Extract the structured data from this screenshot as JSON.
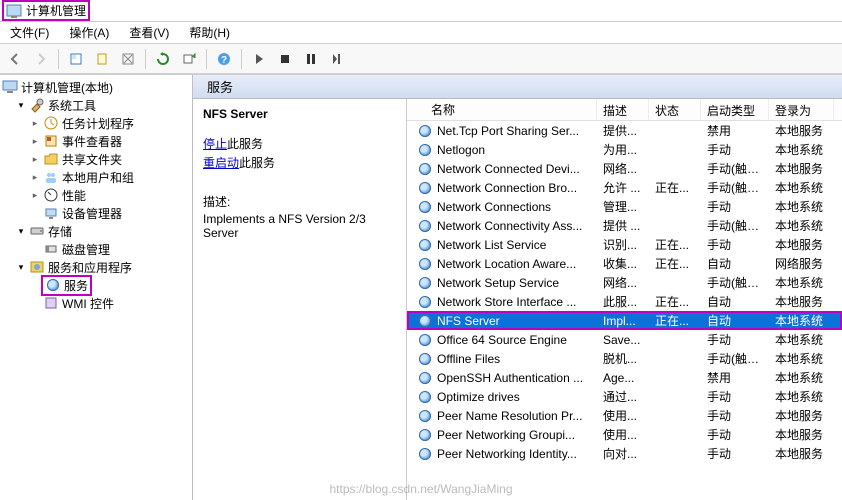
{
  "window": {
    "title": "计算机管理"
  },
  "menus": [
    "文件(F)",
    "操作(A)",
    "查看(V)",
    "帮助(H)"
  ],
  "tree": {
    "root": "计算机管理(本地)",
    "sections": [
      {
        "label": "系统工具",
        "expanded": true,
        "children": [
          {
            "label": "任务计划程序",
            "icon": "clock-icon"
          },
          {
            "label": "事件查看器",
            "icon": "event-icon"
          },
          {
            "label": "共享文件夹",
            "icon": "folder-icon"
          },
          {
            "label": "本地用户和组",
            "icon": "users-icon"
          },
          {
            "label": "性能",
            "icon": "perf-icon"
          },
          {
            "label": "设备管理器",
            "icon": "device-icon"
          }
        ]
      },
      {
        "label": "存储",
        "expanded": true,
        "children": [
          {
            "label": "磁盘管理",
            "icon": "disk-icon"
          }
        ]
      },
      {
        "label": "服务和应用程序",
        "expanded": true,
        "children": [
          {
            "label": "服务",
            "icon": "gear-icon",
            "highlighted": true
          },
          {
            "label": "WMI 控件",
            "icon": "wmi-icon"
          }
        ]
      }
    ]
  },
  "right": {
    "header": "服务",
    "detail": {
      "selected": "NFS Server",
      "stop_link": "停止",
      "stop_suffix": "此服务",
      "restart_link": "重启动",
      "restart_suffix": "此服务",
      "desc_label": "描述:",
      "desc_text": "Implements a NFS Version 2/3 Server"
    },
    "columns": [
      "名称",
      "描述",
      "状态",
      "启动类型",
      "登录为"
    ],
    "services": [
      {
        "name": "Net.Tcp Port Sharing Ser...",
        "desc": "提供...",
        "state": "",
        "start": "禁用",
        "logon": "本地服务"
      },
      {
        "name": "Netlogon",
        "desc": "为用...",
        "state": "",
        "start": "手动",
        "logon": "本地系统"
      },
      {
        "name": "Network Connected Devi...",
        "desc": "网络...",
        "state": "",
        "start": "手动(触发...",
        "logon": "本地服务"
      },
      {
        "name": "Network Connection Bro...",
        "desc": "允许 ...",
        "state": "正在...",
        "start": "手动(触发...",
        "logon": "本地系统"
      },
      {
        "name": "Network Connections",
        "desc": "管理...",
        "state": "",
        "start": "手动",
        "logon": "本地系统"
      },
      {
        "name": "Network Connectivity Ass...",
        "desc": "提供 ...",
        "state": "",
        "start": "手动(触发...",
        "logon": "本地系统"
      },
      {
        "name": "Network List Service",
        "desc": "识别...",
        "state": "正在...",
        "start": "手动",
        "logon": "本地服务"
      },
      {
        "name": "Network Location Aware...",
        "desc": "收集...",
        "state": "正在...",
        "start": "自动",
        "logon": "网络服务"
      },
      {
        "name": "Network Setup Service",
        "desc": "网络...",
        "state": "",
        "start": "手动(触发...",
        "logon": "本地系统"
      },
      {
        "name": "Network Store Interface ...",
        "desc": "此服...",
        "state": "正在...",
        "start": "自动",
        "logon": "本地服务"
      },
      {
        "name": "NFS Server",
        "desc": "Impl...",
        "state": "正在...",
        "start": "自动",
        "logon": "本地系统",
        "selected": true,
        "highlighted": true
      },
      {
        "name": "Office 64 Source Engine",
        "desc": "Save...",
        "state": "",
        "start": "手动",
        "logon": "本地系统"
      },
      {
        "name": "Offline Files",
        "desc": "脱机...",
        "state": "",
        "start": "手动(触发...",
        "logon": "本地系统"
      },
      {
        "name": "OpenSSH Authentication ...",
        "desc": "Age...",
        "state": "",
        "start": "禁用",
        "logon": "本地系统"
      },
      {
        "name": "Optimize drives",
        "desc": "通过...",
        "state": "",
        "start": "手动",
        "logon": "本地系统"
      },
      {
        "name": "Peer Name Resolution Pr...",
        "desc": "使用...",
        "state": "",
        "start": "手动",
        "logon": "本地服务"
      },
      {
        "name": "Peer Networking Groupi...",
        "desc": "使用...",
        "state": "",
        "start": "手动",
        "logon": "本地服务"
      },
      {
        "name": "Peer Networking Identity...",
        "desc": "向对...",
        "state": "",
        "start": "手动",
        "logon": "本地服务"
      }
    ]
  },
  "watermark": "https://blog.csdn.net/WangJiaMing"
}
